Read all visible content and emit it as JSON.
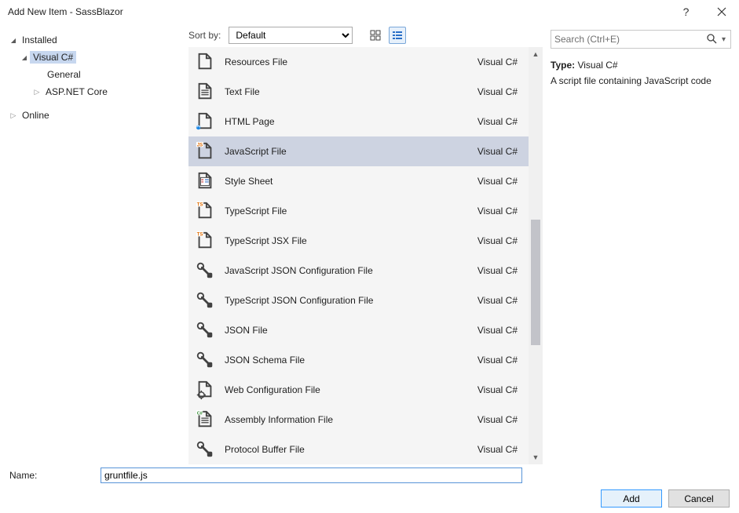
{
  "window": {
    "title": "Add New Item - SassBlazor"
  },
  "tree": {
    "installed": "Installed",
    "vcs": "Visual C#",
    "general": "General",
    "aspnet": "ASP.NET Core",
    "online": "Online"
  },
  "toolbar": {
    "sort_label": "Sort by:",
    "sort_value": "Default"
  },
  "search": {
    "placeholder": "Search (Ctrl+E)"
  },
  "templates": [
    {
      "name": "Resources File",
      "lang": "Visual C#",
      "icon": "resources"
    },
    {
      "name": "Text File",
      "lang": "Visual C#",
      "icon": "text"
    },
    {
      "name": "HTML Page",
      "lang": "Visual C#",
      "icon": "html"
    },
    {
      "name": "JavaScript File",
      "lang": "Visual C#",
      "icon": "js",
      "selected": true
    },
    {
      "name": "Style Sheet",
      "lang": "Visual C#",
      "icon": "css"
    },
    {
      "name": "TypeScript File",
      "lang": "Visual C#",
      "icon": "ts"
    },
    {
      "name": "TypeScript JSX File",
      "lang": "Visual C#",
      "icon": "ts"
    },
    {
      "name": "JavaScript JSON Configuration File",
      "lang": "Visual C#",
      "icon": "json"
    },
    {
      "name": "TypeScript JSON Configuration File",
      "lang": "Visual C#",
      "icon": "json"
    },
    {
      "name": "JSON File",
      "lang": "Visual C#",
      "icon": "json"
    },
    {
      "name": "JSON Schema File",
      "lang": "Visual C#",
      "icon": "json"
    },
    {
      "name": "Web Configuration File",
      "lang": "Visual C#",
      "icon": "webconfig"
    },
    {
      "name": "Assembly Information File",
      "lang": "Visual C#",
      "icon": "asm"
    },
    {
      "name": "Protocol Buffer File",
      "lang": "Visual C#",
      "icon": "proto"
    }
  ],
  "details": {
    "type_label": "Type:",
    "type_value": "Visual C#",
    "description": "A script file containing JavaScript code"
  },
  "footer": {
    "name_label": "Name:",
    "name_value": "gruntfile.js",
    "add": "Add",
    "cancel": "Cancel"
  }
}
